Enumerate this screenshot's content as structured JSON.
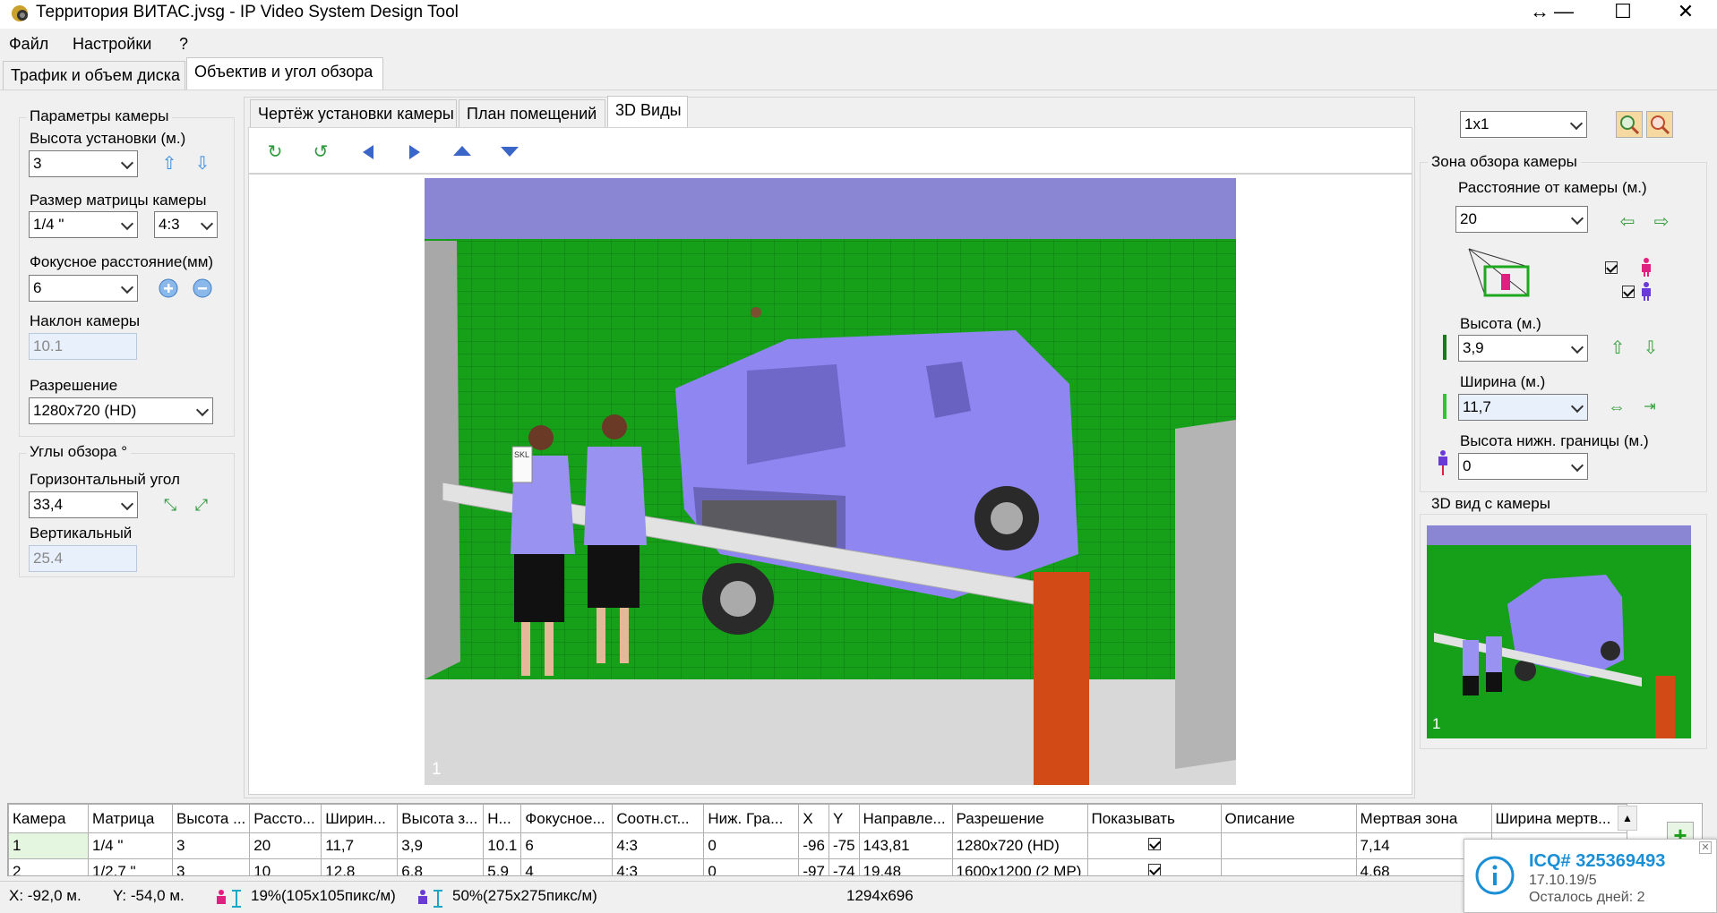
{
  "window": {
    "title": "Территория ВИТАС.jvsg - IP Video System Design Tool",
    "controls": {
      "resize": "↔",
      "minimize": "—",
      "maximize": "☐",
      "close": "✕"
    }
  },
  "menu": [
    "Файл",
    "Настройки",
    "?"
  ],
  "main_tabs": [
    "Трафик и объем диска",
    "Объектив и угол обзора"
  ],
  "view_tabs": [
    "Чертёж установки камеры",
    "План помещений",
    "3D Виды"
  ],
  "camera_params": {
    "group_label": "Параметры камеры",
    "height_label": "Высота установки (м.)",
    "height_value": "3",
    "matrix_label": "Размер матрицы камеры",
    "matrix_value": "1/4 \"",
    "aspect_value": "4:3",
    "focal_label": "Фокусное расстояние(мм)",
    "focal_value": "6",
    "tilt_label": "Наклон камеры",
    "tilt_value": "10.1",
    "resolution_label": "Разрешение",
    "resolution_value": "1280x720 (HD)"
  },
  "view_angles": {
    "group_label": "Углы обзора °",
    "horizontal_label": "Горизонтальный угол",
    "horizontal_value": "33,4",
    "vertical_label": "Вертикальный",
    "vertical_value": "25.4"
  },
  "layout_select": "1x1",
  "zone": {
    "group_label": "Зона обзора камеры",
    "distance_label": "Расстояние от камеры (м.)",
    "distance_value": "20",
    "height_label": "Высота (м.)",
    "height_value": "3,9",
    "width_label": "Ширина (м.)",
    "width_value": "11,7",
    "lower_label": "Высота нижн. границы (м.)",
    "lower_value": "0"
  },
  "camera_view": {
    "group_label": "3D вид с камеры",
    "index": "1"
  },
  "viewport_index": "1",
  "sign_text": "SKL",
  "table": {
    "headers": [
      "Камера",
      "Матрица",
      "Высота ...",
      "Рассто...",
      "Ширин...",
      "Высота з...",
      "Н...",
      "Фокусное...",
      "Соотн.ст...",
      "Ниж. Гра...",
      "X",
      "Y",
      "Направле...",
      "Разрешение",
      "Показывать",
      "Описание",
      "Мертвая зона",
      "Ширина мертв..."
    ],
    "rows": [
      [
        "1",
        "1/4 \"",
        "3",
        "20",
        "11,7",
        "3,9",
        "10.1",
        "6",
        "4:3",
        "0",
        "-96",
        "-75",
        "143,81",
        "1280x720 (HD)",
        "check",
        "",
        "7,14",
        ""
      ],
      [
        "2",
        "1/2.7 \"",
        "3",
        "10",
        "12,8",
        "6,8",
        "5,9",
        "4",
        "4:3",
        "0",
        "-97",
        "-74",
        "19,48",
        "1600x1200 (2 MP)",
        "check",
        "",
        "4,68",
        ""
      ]
    ]
  },
  "status": {
    "x": "X: -92,0 м.",
    "y": "Y: -54,0 м.",
    "pink": "19%(105x105пикс/м)",
    "purple": "50%(275x275пикс/м)",
    "size": "1294x696"
  },
  "toast": {
    "title": "ICQ# 325369493",
    "date": "17.10.19/5",
    "days": "Осталось дней: 2"
  },
  "colors": {
    "ground_green": "#1a9a1a",
    "sky": "#8a86d4",
    "van": "#8f86f2",
    "barrier_post": "#d24a16",
    "icq_blue": "#1a8fd6"
  }
}
